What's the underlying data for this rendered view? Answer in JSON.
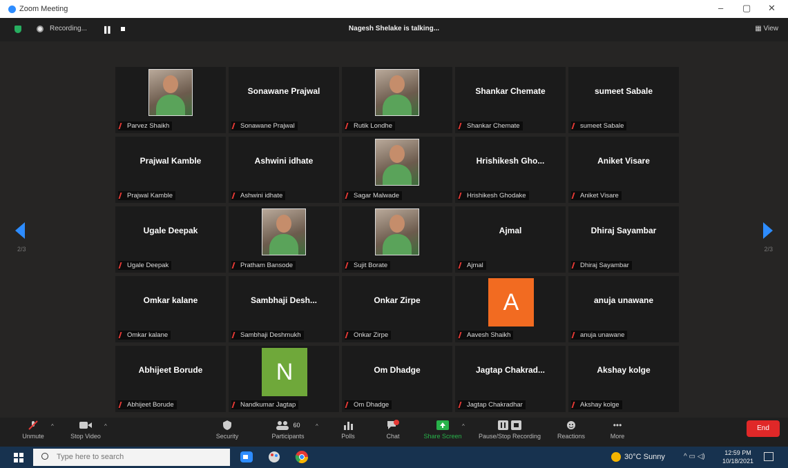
{
  "window": {
    "title": "Zoom Meeting",
    "minimize": "–",
    "restore": "▢",
    "close": "✕"
  },
  "topbar": {
    "recording_label": "Recording...",
    "talking": "Nagesh Shelake is talking...",
    "view_label": "View"
  },
  "pagination": {
    "left": "2/3",
    "right": "2/3"
  },
  "tiles": [
    {
      "display": "",
      "label": "Parvez Shaikh",
      "media": "photo"
    },
    {
      "display": "Sonawane Prajwal",
      "label": "Sonawane Prajwal",
      "media": "name"
    },
    {
      "display": "",
      "label": "Rutik Londhe",
      "media": "photo"
    },
    {
      "display": "Shankar Chemate",
      "label": "Shankar Chemate",
      "media": "name"
    },
    {
      "display": "sumeet Sabale",
      "label": "sumeet Sabale",
      "media": "name"
    },
    {
      "display": "Prajwal Kamble",
      "label": "Prajwal Kamble",
      "media": "name"
    },
    {
      "display": "Ashwini idhate",
      "label": "Ashwini idhate",
      "media": "name"
    },
    {
      "display": "",
      "label": "Sagar Malwade",
      "media": "photo"
    },
    {
      "display": "Hrishikesh Gho...",
      "label": "Hrishikesh Ghodake",
      "media": "name"
    },
    {
      "display": "Aniket Visare",
      "label": "Aniket Visare",
      "media": "name"
    },
    {
      "display": "Ugale Deepak",
      "label": "Ugale Deepak",
      "media": "name"
    },
    {
      "display": "",
      "label": "Pratham Bansode",
      "media": "photo"
    },
    {
      "display": "",
      "label": "Sujit Borate",
      "media": "photo"
    },
    {
      "display": "Ajmal",
      "label": "Ajmal",
      "media": "name"
    },
    {
      "display": "Dhiraj Sayambar",
      "label": "Dhiraj Sayambar",
      "media": "name"
    },
    {
      "display": "Omkar kalane",
      "label": "Omkar kalane",
      "media": "name"
    },
    {
      "display": "Sambhaji Desh...",
      "label": "Sambhaji Deshmukh",
      "media": "name"
    },
    {
      "display": "Onkar Zirpe",
      "label": "Onkar Zirpe",
      "media": "name"
    },
    {
      "display": "A",
      "label": "Aavesh Shaikh",
      "media": "avatar",
      "color": "#f26b21"
    },
    {
      "display": "anuja unawane",
      "label": "anuja unawane",
      "media": "name"
    },
    {
      "display": "Abhijeet Borude",
      "label": "Abhijeet Borude",
      "media": "name"
    },
    {
      "display": "N",
      "label": "Nandkumar Jagtap",
      "media": "avatar",
      "color": "#6fa83a"
    },
    {
      "display": "Om Dhadge",
      "label": "Om Dhadge",
      "media": "name"
    },
    {
      "display": "Jagtap Chakrad...",
      "label": "Jagtap Chakradhar",
      "media": "name"
    },
    {
      "display": "Akshay kolge",
      "label": "Akshay kolge",
      "media": "name"
    }
  ],
  "controls": {
    "unmute": "Unmute",
    "stop_video": "Stop Video",
    "security": "Security",
    "participants": "Participants",
    "participants_count": "60",
    "polls": "Polls",
    "chat": "Chat",
    "share_screen": "Share Screen",
    "pause_recording": "Pause/Stop Recording",
    "reactions": "Reactions",
    "more": "More",
    "end": "End"
  },
  "taskbar": {
    "search_placeholder": "Type here to search",
    "weather": "30°C  Sunny",
    "time": "12:59 PM",
    "date": "10/18/2021"
  },
  "colors": {
    "accent": "#2d8cff",
    "share": "#28b34a",
    "end": "#e02828",
    "muted": "#e53935"
  }
}
